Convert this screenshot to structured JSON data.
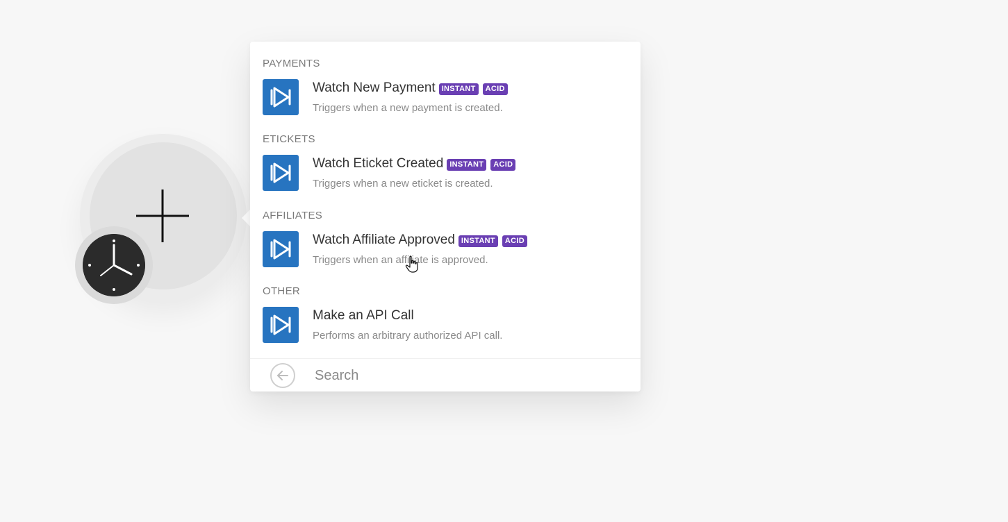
{
  "sections": [
    {
      "title": "PAYMENTS",
      "item": {
        "name": "Watch New Payment",
        "badges": [
          "INSTANT",
          "ACID"
        ],
        "description": "Triggers when a new payment is created."
      }
    },
    {
      "title": "ETICKETS",
      "item": {
        "name": "Watch Eticket Created",
        "badges": [
          "INSTANT",
          "ACID"
        ],
        "description": "Triggers when a new eticket is created."
      }
    },
    {
      "title": "AFFILIATES",
      "item": {
        "name": "Watch Affiliate Approved",
        "badges": [
          "INSTANT",
          "ACID"
        ],
        "description": "Triggers when an affiliate is approved."
      }
    },
    {
      "title": "OTHER",
      "item": {
        "name": "Make an API Call",
        "badges": [],
        "description": "Performs an arbitrary authorized API call."
      }
    }
  ],
  "search": {
    "placeholder": "Search"
  },
  "icons": {
    "module_plus": "plus-icon",
    "trigger": "clock-icon",
    "app_logo": "app-logo-icon",
    "back": "arrow-left-icon",
    "cursor": "hand-pointer-icon"
  },
  "colors": {
    "app_logo_bg": "#2774c0",
    "badge_bg": "#6a3fb3",
    "clock_bg": "#2b2b2b",
    "node_bg": "#e2e2e2"
  }
}
